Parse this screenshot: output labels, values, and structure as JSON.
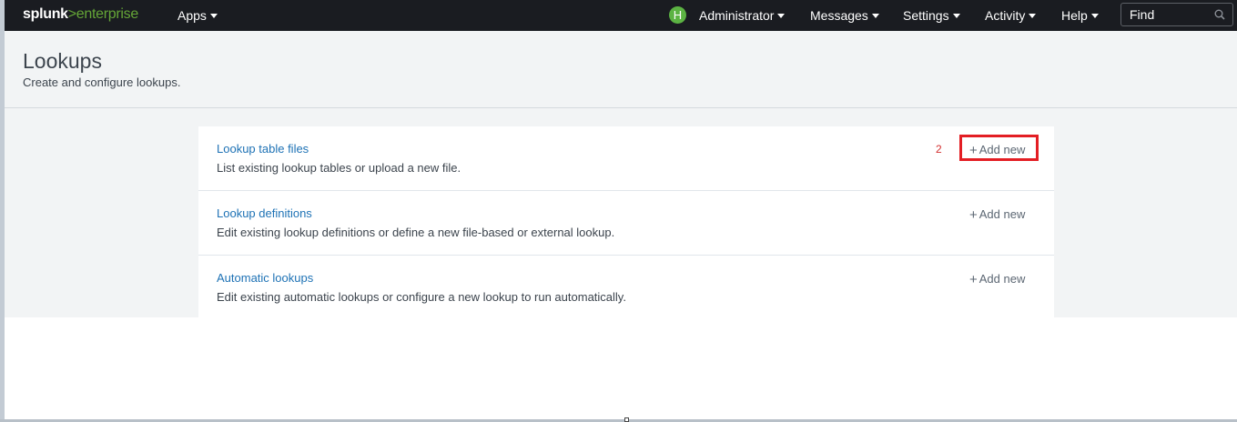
{
  "topbar": {
    "logo_left": "splunk",
    "logo_right": ">enterprise",
    "apps": "Apps",
    "avatar_initial": "H",
    "user": "Administrator",
    "messages": "Messages",
    "settings": "Settings",
    "activity": "Activity",
    "help": "Help",
    "find_placeholder": "Find"
  },
  "page": {
    "title": "Lookups",
    "description": "Create and configure lookups."
  },
  "annotation": {
    "step_number": "2",
    "highlight_color": "#e31e24"
  },
  "items": [
    {
      "title": "Lookup table files",
      "description": "List existing lookup tables or upload a new file.",
      "action": "Add new"
    },
    {
      "title": "Lookup definitions",
      "description": "Edit existing lookup definitions or define a new file-based or external lookup.",
      "action": "Add new"
    },
    {
      "title": "Automatic lookups",
      "description": "Edit existing automatic lookups or configure a new lookup to run automatically.",
      "action": "Add new"
    }
  ],
  "colors": {
    "topbar": "#1a1c21",
    "brand_green": "#65a637",
    "link": "#1e72b5",
    "page_bg": "#f2f4f5"
  }
}
